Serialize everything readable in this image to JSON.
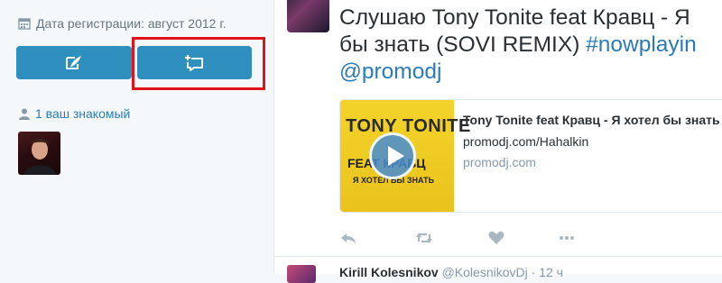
{
  "profile": {
    "joined": "Дата регистрации: август 2012 г.",
    "friends_link": "1 ваш знакомый"
  },
  "buttons": {
    "tweet_to": "tweet-to-icon",
    "message": "direct-message-icon"
  },
  "tweet": {
    "text_line1": "Слушаю Tony Tonite feat Кравц - Я",
    "text_line2_plain": "бы знать (SOVI REMIX) ",
    "hashtag": "#nowplayin",
    "mention": "@promodj",
    "card": {
      "title": "Tony  Tonite feat Кравц - Я хотел бы знать",
      "description": "promodj.com/Hahalkin",
      "domain": "promodj.com",
      "thumb_line1": "TONY TONITE",
      "thumb_line2": "FEAT КРАВЦ",
      "thumb_line3": "Я ХОТЕЛ БЫ ЗНАТЬ"
    },
    "actions": [
      "reply-icon",
      "retweet-icon",
      "like-icon",
      "more-icon"
    ]
  },
  "next_tweet": {
    "name": "Kirill Kolesnikov",
    "handle": "@KolesnikovDj · 12 ч"
  },
  "colors": {
    "accent_button": "#2f8fbf",
    "link": "#2b7bb9",
    "highlight_box": "#e0131a"
  }
}
